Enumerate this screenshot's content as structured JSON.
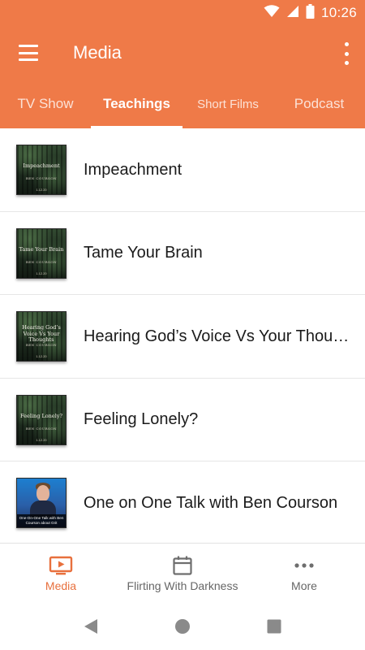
{
  "status_bar": {
    "time": "10:26",
    "icons": [
      "wifi-icon",
      "signal-icon",
      "battery-icon"
    ]
  },
  "app_bar": {
    "title": "Media",
    "menu_icon": "hamburger-menu-icon",
    "overflow_icon": "more-vertical-icon"
  },
  "tabs": [
    {
      "label": "TV Show",
      "active": false
    },
    {
      "label": "Teachings",
      "active": true
    },
    {
      "label": "Short Films",
      "active": false
    },
    {
      "label": "Podcast",
      "active": false
    }
  ],
  "items": [
    {
      "title": "Impeachment",
      "thumb_title": "Impeachment",
      "thumb_sub": "BEN COURSON",
      "thumb_date": "1.12.20"
    },
    {
      "title": "Tame Your Brain",
      "thumb_title": "Tame Your Brain",
      "thumb_sub": "BEN COURSON",
      "thumb_date": "1.12.20"
    },
    {
      "title": "Hearing God’s Voice Vs Your Thoughts",
      "thumb_title": "Hearing God’s Voice Vs Your Thoughts",
      "thumb_sub": "BEN COURSON",
      "thumb_date": "1.12.20"
    },
    {
      "title": "Feeling Lonely?",
      "thumb_title": "Feeling Lonely?",
      "thumb_sub": "BEN COURSON",
      "thumb_date": "1.12.20"
    },
    {
      "title": "One on One Talk with Ben Courson",
      "thumb_caption": "One-On-One Talk with Ben Courson about Grit"
    }
  ],
  "bottom_nav": [
    {
      "label": "Media",
      "icon": "tv-play-icon",
      "active": true
    },
    {
      "label": "Flirting With Darkness",
      "icon": "calendar-icon",
      "active": false
    },
    {
      "label": "More",
      "icon": "more-horizontal-icon",
      "active": false
    }
  ],
  "system_nav": [
    "back-icon",
    "home-icon",
    "recents-icon"
  ],
  "colors": {
    "primary": "#ef7a48",
    "accent": "#e8703d",
    "text": "#1b1b1b"
  }
}
